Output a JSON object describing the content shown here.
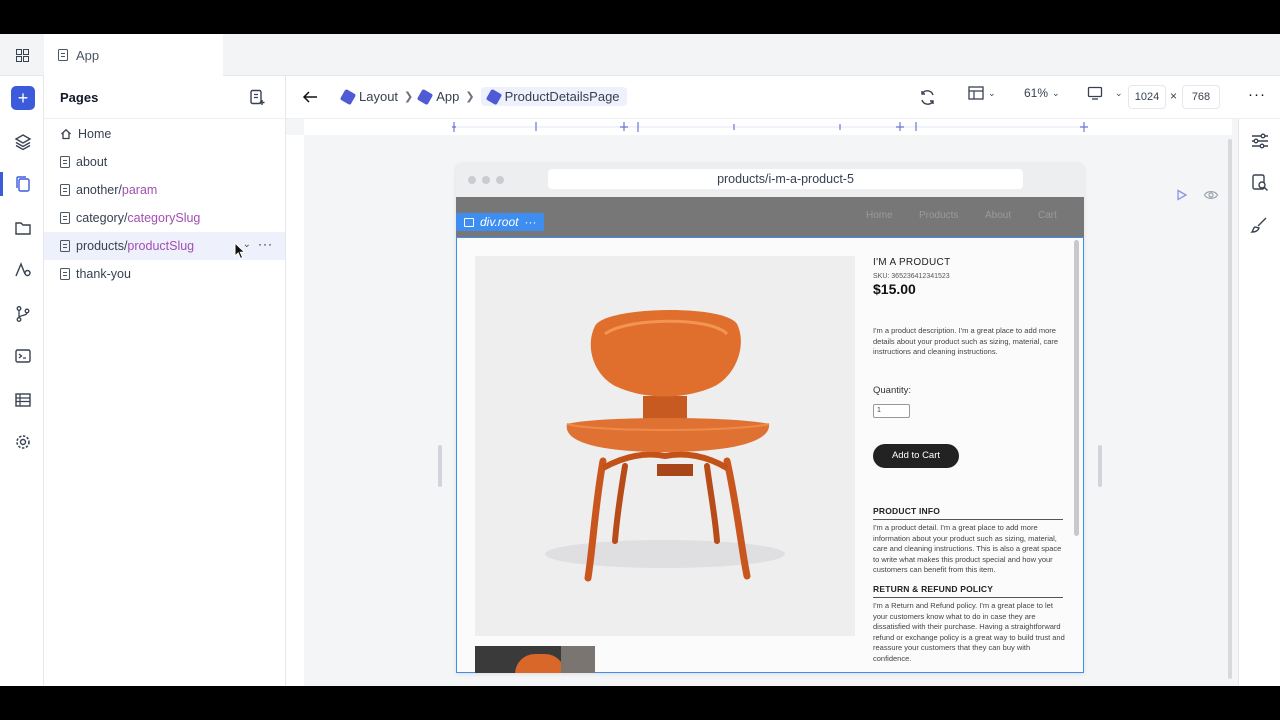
{
  "tab": {
    "label": "App"
  },
  "pages_panel": {
    "title": "Pages",
    "items": [
      {
        "base": "Home",
        "param": ""
      },
      {
        "base": "about",
        "param": ""
      },
      {
        "base": "another/",
        "param": "param"
      },
      {
        "base": "category/",
        "param": "categorySlug"
      },
      {
        "base": "products/",
        "param": "productSlug"
      },
      {
        "base": "thank-you",
        "param": ""
      }
    ]
  },
  "breadcrumb": {
    "item1": "Layout",
    "item2": "App",
    "current": "ProductDetailsPage"
  },
  "toolbar": {
    "zoom": "61%",
    "width": "1024",
    "times": "×",
    "height": "768"
  },
  "frame": {
    "url": "products/i-m-a-product-5",
    "selected_tag": "div.root"
  },
  "site": {
    "nav": [
      "Home",
      "Products",
      "About",
      "Cart"
    ],
    "product_title": "I'M A PRODUCT",
    "sku": "SKU: 365236412341523",
    "price": "$15.00",
    "description": "I'm a product description. I'm a great place to add more details about your product such as sizing, material, care instructions and cleaning instructions.",
    "quantity_label": "Quantity:",
    "quantity_value": "1",
    "add_to_cart": "Add to Cart",
    "info_title": "PRODUCT INFO",
    "info_text": "I'm a product detail. I'm a great place to add more information about your product such as sizing, material, care and cleaning instructions. This is also a great space to write what makes this product special and how your customers can benefit from this item.",
    "refund_title": "RETURN & REFUND POLICY",
    "refund_text": "I'm a Return and Refund policy. I'm a great place to let your customers know what to do in case they are dissatisfied with their purchase. Having a straightforward refund or exchange policy is a great way to build trust and reassure your customers that they can buy with confidence."
  },
  "colors": {
    "accent": "#3b5bdb",
    "selection": "#3d8ef0",
    "param": "#a24fb0",
    "chair": "#d9672a"
  }
}
